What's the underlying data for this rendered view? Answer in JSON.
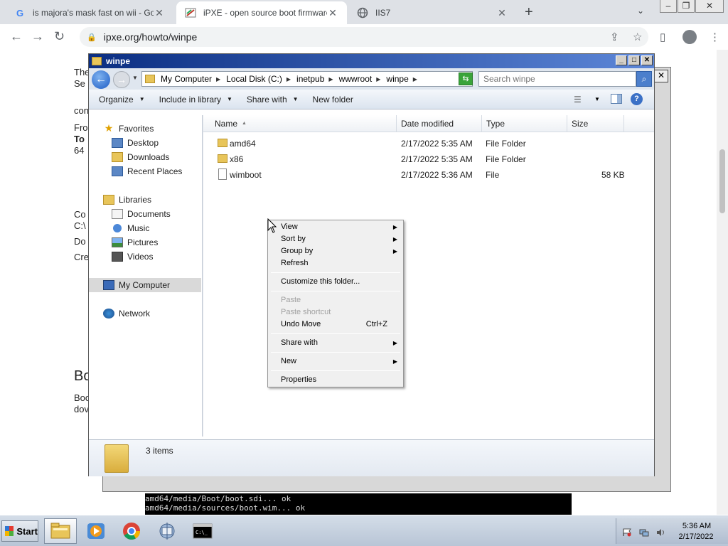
{
  "browser": {
    "tabs": [
      {
        "title": "is majora's mask fast on wii - Googl",
        "favicon": "google-icon"
      },
      {
        "title": "iPXE - open source boot firmware [",
        "favicon": "ipxe-icon"
      },
      {
        "title": "IIS7",
        "favicon": "globe-icon"
      }
    ],
    "address": "ipxe.org/howto/winpe"
  },
  "webpage": {
    "fragments": [
      "The",
      "Se",
      "con",
      "Fro",
      "To",
      "64",
      "Co",
      "C:\\",
      "Do",
      "Cre",
      "Bo",
      "Boo",
      "dov"
    ]
  },
  "console": {
    "lines": [
      "amd64/media/Boot/boot.sdi... ok",
      "amd64/media/sources/boot.wim... ok"
    ]
  },
  "explorer": {
    "title": "winpe",
    "breadcrumbs": [
      "My Computer",
      "Local Disk (C:)",
      "inetpub",
      "wwwroot",
      "winpe"
    ],
    "search_placeholder": "Search winpe",
    "commands": [
      "Organize",
      "Include in library",
      "Share with",
      "New folder"
    ],
    "nav": {
      "favorites": "Favorites",
      "favorite_items": [
        "Desktop",
        "Downloads",
        "Recent Places"
      ],
      "libraries": "Libraries",
      "library_items": [
        "Documents",
        "Music",
        "Pictures",
        "Videos"
      ],
      "computer": "My Computer",
      "network": "Network"
    },
    "columns": [
      "Name",
      "Date modified",
      "Type",
      "Size"
    ],
    "files": [
      {
        "name": "amd64",
        "date": "2/17/2022 5:35 AM",
        "type": "File Folder",
        "size": ""
      },
      {
        "name": "x86",
        "date": "2/17/2022 5:35 AM",
        "type": "File Folder",
        "size": ""
      },
      {
        "name": "wimboot",
        "date": "2/17/2022 5:36 AM",
        "type": "File",
        "size": "58 KB"
      }
    ],
    "status": "3 items"
  },
  "context_menu": {
    "view": "View",
    "sort_by": "Sort by",
    "group_by": "Group by",
    "refresh": "Refresh",
    "customize": "Customize this folder...",
    "paste": "Paste",
    "paste_shortcut": "Paste shortcut",
    "undo_move": "Undo Move",
    "undo_shortcut": "Ctrl+Z",
    "share_with": "Share with",
    "new": "New",
    "properties": "Properties"
  },
  "taskbar": {
    "start": "Start",
    "time": "5:36 AM",
    "date": "2/17/2022"
  },
  "colors": {
    "title_bar": "#0b2e82",
    "chrome_tabbar": "#dee1e6",
    "context_menu_bg": "#f0f0f0"
  }
}
